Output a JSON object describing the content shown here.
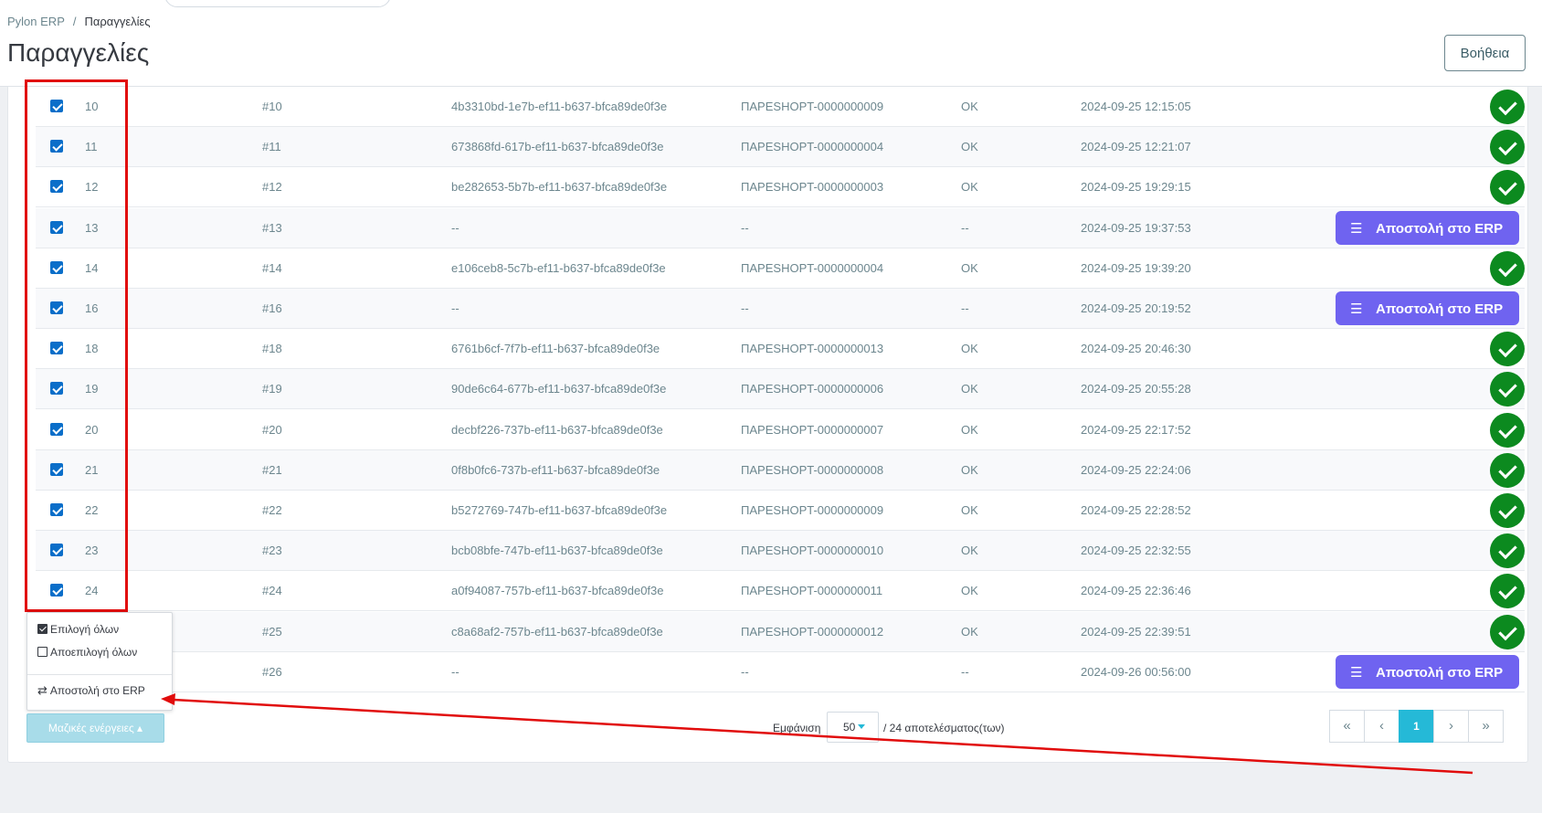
{
  "breadcrumb": {
    "root": "Pylon ERP",
    "separator": "/",
    "current": "Παραγγελίες"
  },
  "page": {
    "title": "Παραγγελίες",
    "help_label": "Βοήθεια"
  },
  "rows": [
    {
      "id": "10",
      "ref": "#10",
      "uuid": "4b3310bd-1e7b-ef11-b637-bfca89de0f3e",
      "doc": "ΠΑΡΕSHOPT-0000000009",
      "status": "OK",
      "date": "2024-09-25 12:15:05",
      "action": "ok",
      "checked": true
    },
    {
      "id": "11",
      "ref": "#11",
      "uuid": "673868fd-617b-ef11-b637-bfca89de0f3e",
      "doc": "ΠΑΡΕSHOPT-0000000004",
      "status": "OK",
      "date": "2024-09-25 12:21:07",
      "action": "ok",
      "checked": true
    },
    {
      "id": "12",
      "ref": "#12",
      "uuid": "be282653-5b7b-ef11-b637-bfca89de0f3e",
      "doc": "ΠΑΡΕSHOPT-0000000003",
      "status": "OK",
      "date": "2024-09-25 19:29:15",
      "action": "ok",
      "checked": true
    },
    {
      "id": "13",
      "ref": "#13",
      "uuid": "--",
      "doc": "--",
      "status": "--",
      "date": "2024-09-25 19:37:53",
      "action": "send",
      "checked": true
    },
    {
      "id": "14",
      "ref": "#14",
      "uuid": "e106ceb8-5c7b-ef11-b637-bfca89de0f3e",
      "doc": "ΠΑΡΕSHOPT-0000000004",
      "status": "OK",
      "date": "2024-09-25 19:39:20",
      "action": "ok",
      "checked": true
    },
    {
      "id": "16",
      "ref": "#16",
      "uuid": "--",
      "doc": "--",
      "status": "--",
      "date": "2024-09-25 20:19:52",
      "action": "send",
      "checked": true
    },
    {
      "id": "18",
      "ref": "#18",
      "uuid": "6761b6cf-7f7b-ef11-b637-bfca89de0f3e",
      "doc": "ΠΑΡΕSHOPT-0000000013",
      "status": "OK",
      "date": "2024-09-25 20:46:30",
      "action": "ok",
      "checked": true
    },
    {
      "id": "19",
      "ref": "#19",
      "uuid": "90de6c64-677b-ef11-b637-bfca89de0f3e",
      "doc": "ΠΑΡΕSHOPT-0000000006",
      "status": "OK",
      "date": "2024-09-25 20:55:28",
      "action": "ok",
      "checked": true
    },
    {
      "id": "20",
      "ref": "#20",
      "uuid": "decbf226-737b-ef11-b637-bfca89de0f3e",
      "doc": "ΠΑΡΕSHOPT-0000000007",
      "status": "OK",
      "date": "2024-09-25 22:17:52",
      "action": "ok",
      "checked": true
    },
    {
      "id": "21",
      "ref": "#21",
      "uuid": "0f8b0fc6-737b-ef11-b637-bfca89de0f3e",
      "doc": "ΠΑΡΕSHOPT-0000000008",
      "status": "OK",
      "date": "2024-09-25 22:24:06",
      "action": "ok",
      "checked": true
    },
    {
      "id": "22",
      "ref": "#22",
      "uuid": "b5272769-747b-ef11-b637-bfca89de0f3e",
      "doc": "ΠΑΡΕSHOPT-0000000009",
      "status": "OK",
      "date": "2024-09-25 22:28:52",
      "action": "ok",
      "checked": true
    },
    {
      "id": "23",
      "ref": "#23",
      "uuid": "bcb08bfe-747b-ef11-b637-bfca89de0f3e",
      "doc": "ΠΑΡΕSHOPT-0000000010",
      "status": "OK",
      "date": "2024-09-25 22:32:55",
      "action": "ok",
      "checked": true
    },
    {
      "id": "24",
      "ref": "#24",
      "uuid": "a0f94087-757b-ef11-b637-bfca89de0f3e",
      "doc": "ΠΑΡΕSHOPT-0000000011",
      "status": "OK",
      "date": "2024-09-25 22:36:46",
      "action": "ok",
      "checked": true
    },
    {
      "id": "",
      "ref": "#25",
      "uuid": "c8a68af2-757b-ef11-b637-bfca89de0f3e",
      "doc": "ΠΑΡΕSHOPT-0000000012",
      "status": "OK",
      "date": "2024-09-25 22:39:51",
      "action": "ok",
      "checked": false
    },
    {
      "id": "",
      "ref": "#26",
      "uuid": "--",
      "doc": "--",
      "status": "--",
      "date": "2024-09-26 00:56:00",
      "action": "send",
      "checked": false
    }
  ],
  "send_erp_label": "Αποστολή στο ERP",
  "icons": {
    "ok": "check-circle-icon",
    "send": "send-list-icon",
    "bulk_caret": "caret-up-icon",
    "select_all": "checked-box-icon",
    "deselect_all": "empty-box-icon",
    "transfer": "transfer-arrows-icon"
  },
  "bulk_menu": {
    "select_all": "Επιλογή όλων",
    "deselect_all": "Αποεπιλογή όλων",
    "send_to_erp": "Αποστολή στο ERP"
  },
  "bulk_button": "Μαζικές ενέργειες ▴",
  "pagination": {
    "show_label": "Εμφάνιση",
    "page_size": "50",
    "results_text": "/ 24 αποτελέσματος(των)",
    "first": "«",
    "prev": "‹",
    "current": "1",
    "next": "›",
    "last": "»"
  },
  "colors": {
    "accent": "#25b9d7",
    "ok": "#0c8a1f",
    "send": "#6f63f0",
    "annotation": "#e10c0c"
  }
}
